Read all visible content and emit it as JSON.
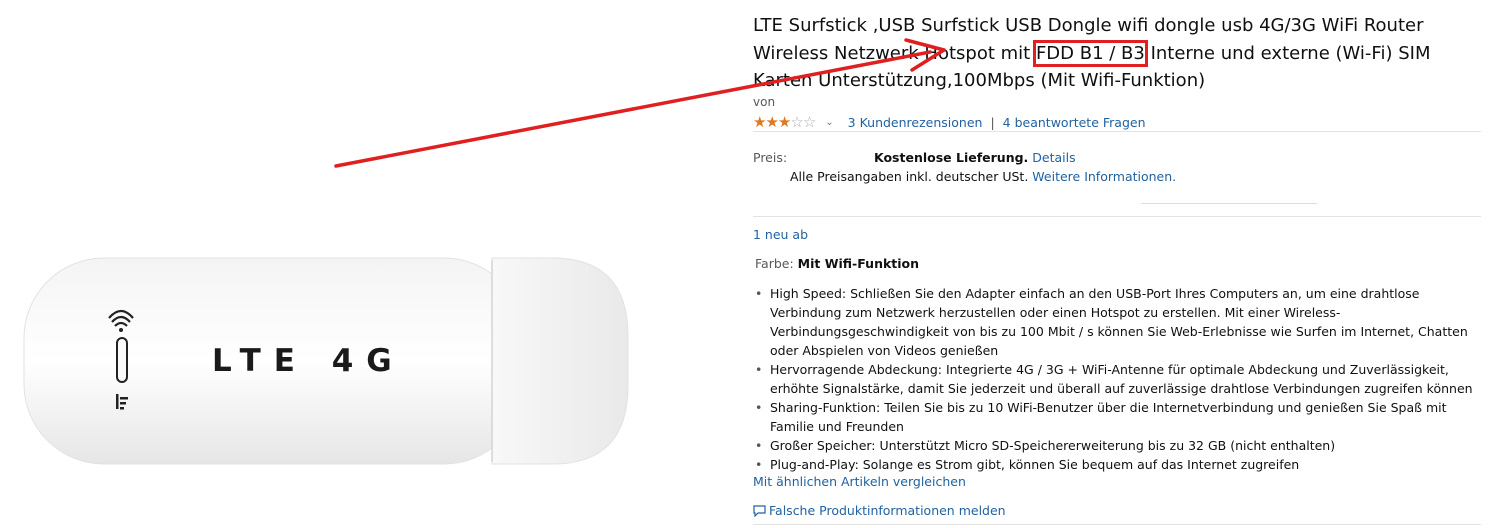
{
  "product": {
    "image_text": "LTE 4G",
    "title_before": "LTE Surfstick ,USB Surfstick USB Dongle wifi dongle usb 4G/3G WiFi Router Wireless Netzwerk Hotspot mit ",
    "title_highlight": "FDD B1 / B3",
    "title_after": " Interne und externe (Wi-Fi) SIM Karten Unterstützung,100Mbps (Mit Wifi-Funktion)",
    "byline": "von",
    "rating": 3,
    "rating_max": 5,
    "reviews_link": "3 Kundenrezensionen",
    "separator": "|",
    "questions_link": "4 beantwortete Fragen"
  },
  "price": {
    "label": "Preis:",
    "shipping_bold": "Kostenlose Lieferung.",
    "details_link": "Details",
    "vat_text": "Alle Preisangaben inkl. deutscher USt.",
    "vat_link": "Weitere Informationen."
  },
  "offers": {
    "new_link": "1 neu ab"
  },
  "variant": {
    "label": "Farbe:",
    "value": "Mit Wifi-Funktion"
  },
  "features": [
    "High Speed: Schließen Sie den Adapter einfach an den USB-Port Ihres Computers an, um eine drahtlose Verbindung zum Netzwerk herzustellen oder einen Hotspot zu erstellen. Mit einer Wireless-Verbindungsgeschwindigkeit von bis zu 100 Mbit / s können Sie Web-Erlebnisse wie Surfen im Internet, Chatten oder Abspielen von Videos genießen",
    "Hervorragende Abdeckung: Integrierte 4G / 3G + WiFi-Antenne für optimale Abdeckung und Zuverlässigkeit, erhöhte Signalstärke, damit Sie jederzeit und überall auf zuverlässige drahtlose Verbindungen zugreifen können",
    "Sharing-Funktion: Teilen Sie bis zu 10 WiFi-Benutzer über die Internetverbindung und genießen Sie Spaß mit Familie und Freunden",
    "Großer Speicher: Unterstützt Micro SD-Speichererweiterung bis zu 32 GB (nicht enthalten)",
    "Plug-and-Play: Solange es Strom gibt, können Sie bequem auf das Internet zugreifen"
  ],
  "links": {
    "compare": "Mit ähnlichen Artikeln vergleichen",
    "report": "Falsche Produktinformationen melden"
  },
  "colors": {
    "link": "#2162a1",
    "star": "#de7921",
    "annotation": "#e02020"
  },
  "icons": {
    "arrow": "annotation-arrow",
    "report": "speech-bubble-icon"
  }
}
